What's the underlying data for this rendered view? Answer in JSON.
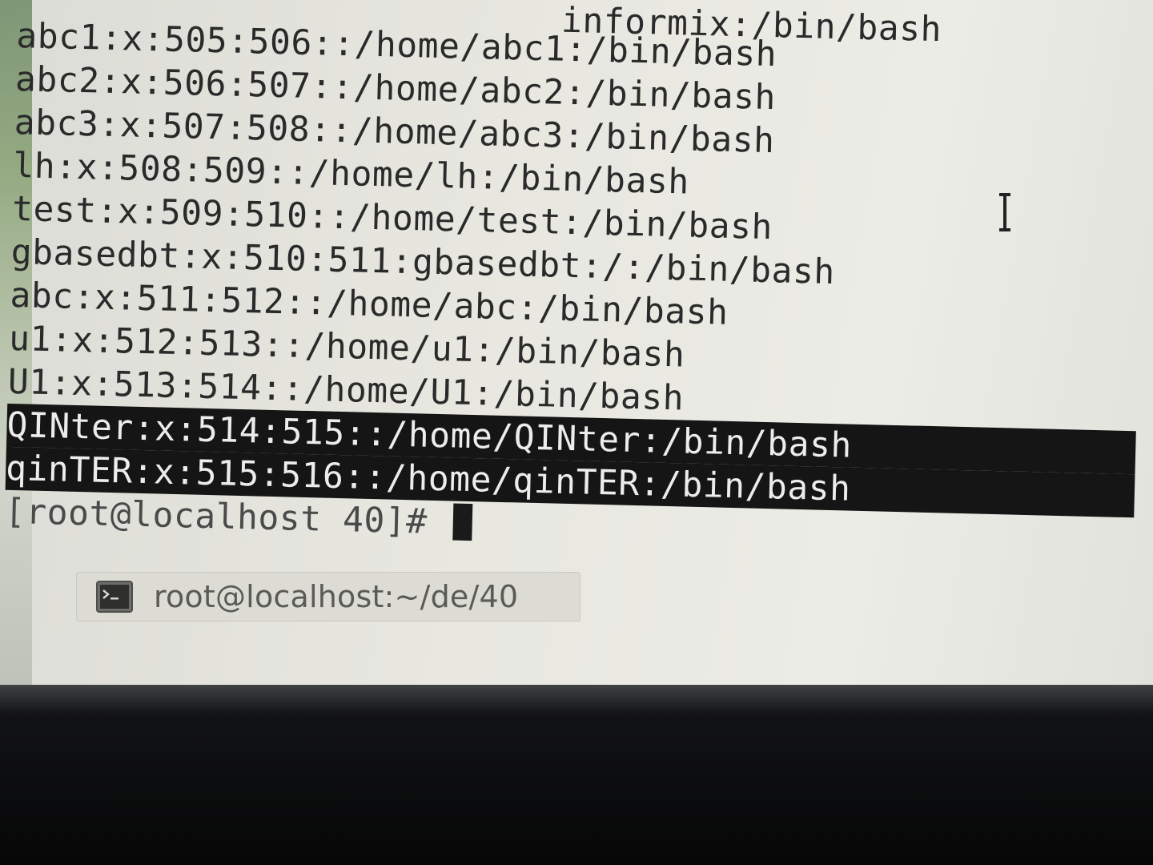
{
  "terminal": {
    "partial_top_line": "informix:/bin/bash",
    "lines": [
      "abc1:x:505:506::/home/abc1:/bin/bash",
      "abc2:x:506:507::/home/abc2:/bin/bash",
      "abc3:x:507:508::/home/abc3:/bin/bash",
      "lh:x:508:509::/home/lh:/bin/bash",
      "test:x:509:510::/home/test:/bin/bash",
      "gbasedbt:x:510:511:gbasedbt:/:/bin/bash",
      "abc:x:511:512::/home/abc:/bin/bash",
      "u1:x:512:513::/home/u1:/bin/bash",
      "U1:x:513:514::/home/U1:/bin/bash"
    ],
    "highlighted_lines": [
      "QINter:x:514:515::/home/QINter:/bin/bash",
      "qinTER:x:515:516::/home/qinTER:/bin/bash"
    ],
    "prompt": "[root@localhost 40]# "
  },
  "taskbar": {
    "window_title": "root@localhost:~/de/40",
    "icon": "terminal-icon"
  },
  "colors": {
    "screen_bg": "#e7e7e0",
    "text": "#2a2a2a",
    "selection_bg": "#151515",
    "selection_text": "#ececec"
  }
}
